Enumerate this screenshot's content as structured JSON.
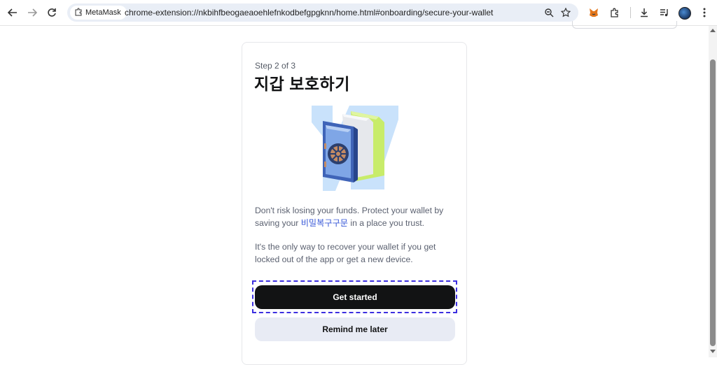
{
  "browser": {
    "site_chip": "MetaMask",
    "url": "chrome-extension://nkbihfbeogaeaoehlefnkodbefgpgknn/home.html#onboarding/secure-your-wallet"
  },
  "onboarding": {
    "step": "Step 2 of 3",
    "title": "지갑 보호하기",
    "p1_before": "Don't risk losing your funds. Protect your wallet by saving your ",
    "p1_link": "비밀복구구문",
    "p1_after": " in a place you trust.",
    "p2": "It's the only way to recover your wallet if you get locked out of the app or get a new device.",
    "primary_label": "Get started",
    "secondary_label": "Remind me later"
  },
  "colors": {
    "primary_button": "#121314",
    "secondary_button": "#e8ebf4",
    "link": "#3b5bd8",
    "focus_ring": "#3c2fe0"
  }
}
